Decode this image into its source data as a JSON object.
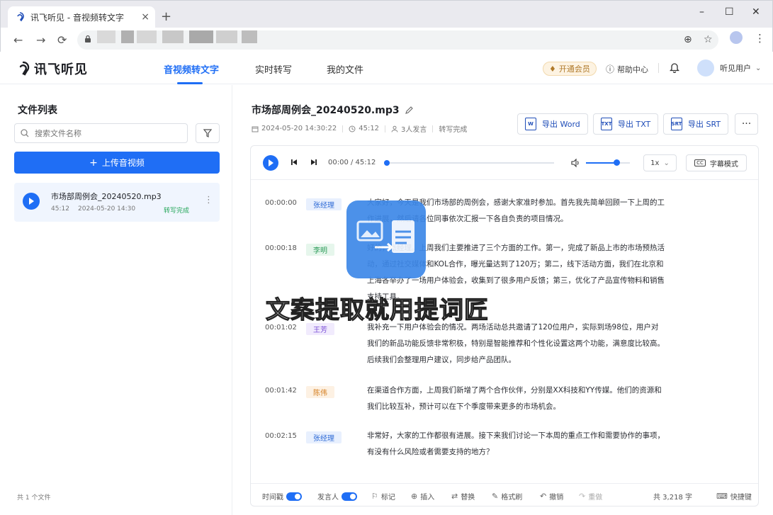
{
  "browser": {
    "tab_title": "讯飞听见 - 音视频转文字",
    "tab_close": "×",
    "new_tab": "+",
    "win_minimize": "–",
    "win_maximize": "☐",
    "win_close": "✕"
  },
  "app": {
    "logo": "讯飞听见",
    "nav": [
      "音视频转文字",
      "实时转写",
      "我的文件"
    ],
    "vip": "开通会员",
    "help": "帮助中心",
    "user": "听见用户"
  },
  "sidebar": {
    "title": "文件列表",
    "search_placeholder": "搜索文件名称",
    "upload": "上传音视频",
    "file": {
      "name": "市场部周例会_20240520.mp3",
      "duration": "45:12",
      "date": "2024-05-20 14:30",
      "status": "转写完成"
    },
    "footer": "共 1 个文件"
  },
  "main": {
    "title": "市场部周例会_20240520.mp3",
    "datetime": "2024-05-20 14:30:22",
    "duration": "45:12",
    "speakers": "3人发言",
    "status": "转写完成",
    "export_word": "导出 Word",
    "export_txt": "导出 TXT",
    "export_srt": "导出 SRT",
    "more": "···"
  },
  "player": {
    "time": "00:00 / 45:12",
    "progress": 0.0,
    "volume": 0.7,
    "speed": "1x",
    "subtitle_mode": "字幕模式"
  },
  "segments": [
    {
      "time": "00:00:00",
      "speaker": "张经理",
      "color": "#e8f0fe",
      "text_color": "#2f6bd6",
      "text": "大家好，今天是我们市场部的周例会，感谢大家准时参加。首先我先简单回顾一下上周的工作进展，然后请各位同事依次汇报一下各自负责的项目情况。"
    },
    {
      "time": "00:00:18",
      "speaker": "李明",
      "color": "#e6f6ec",
      "text_color": "#2a9a57",
      "text": "好的，张经理。上周我们主要推进了三个方面的工作。第一，完成了新品上市的市场预热活动，通过社交媒体和KOL合作，曝光量达到了120万；第二，线下活动方面，我们在北京和上海各举办了一场用户体验会，收集到了很多用户反馈；第三，优化了产品宣传物料和销售支持工具。"
    },
    {
      "time": "00:01:02",
      "speaker": "王芳",
      "color": "#f1ebfd",
      "text_color": "#7b4fd6",
      "text": "我补充一下用户体验会的情况。两场活动总共邀请了120位用户，实际到场98位，用户对我们的新品功能反馈非常积极，特别是智能推荐和个性化设置这两个功能，满意度比较高。后续我们会整理用户建议，同步给产品团队。"
    },
    {
      "time": "00:01:42",
      "speaker": "陈伟",
      "color": "#fdf1e3",
      "text_color": "#d47d1e",
      "text": "在渠道合作方面，上周我们新增了两个合作伙伴，分别是XX科技和YY传媒。他们的资源和我们比较互补，预计可以在下个季度带来更多的市场机会。"
    },
    {
      "time": "00:02:15",
      "speaker": "张经理",
      "color": "#e8f0fe",
      "text_color": "#2f6bd6",
      "text": "非常好，大家的工作都很有进展。接下来我们讨论一下本周的重点工作和需要协作的事项，有没有什么风险或者需要支持的地方？"
    }
  ],
  "bottom": {
    "timestamp": "时间戳",
    "speaker": "发言人",
    "mark": "标记",
    "insert": "插入",
    "replace": "替换",
    "format": "格式刷",
    "undo": "撤销",
    "redo": "重做",
    "word_count": "共 3,218 字",
    "shortcuts": "快捷键"
  },
  "watermark": {
    "text": "文案提取就用提词匠"
  },
  "colors": {
    "accent": "#1f6ef5",
    "success": "#25a75a"
  }
}
